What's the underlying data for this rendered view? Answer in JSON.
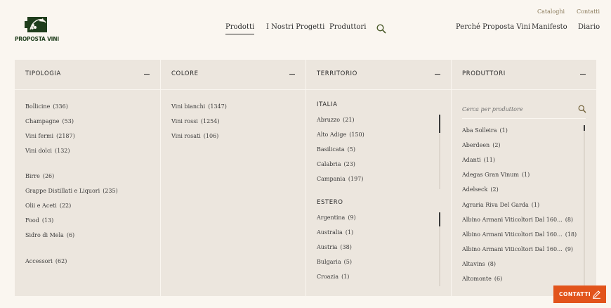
{
  "brand": {
    "name": "PROPOSTA VINI",
    "logo_icon": "grapevine-icon"
  },
  "utility_links": [
    "Cataloghi",
    "Contatti"
  ],
  "main_nav": [
    "Prodotti",
    "I Nostri Progetti",
    "Produttori"
  ],
  "secondary_nav": [
    "Perché Proposta Vini",
    "Manifesto",
    "Diario"
  ],
  "panel": {
    "tipologia": {
      "title": "TIPOLOGIA",
      "group1": [
        {
          "label": "Bollicine",
          "count": "(336)"
        },
        {
          "label": "Champagne",
          "count": "(53)"
        },
        {
          "label": "Vini fermi",
          "count": "(2187)"
        },
        {
          "label": "Vini dolci",
          "count": "(132)"
        }
      ],
      "group2": [
        {
          "label": "Birre",
          "count": "(26)"
        },
        {
          "label": "Grappe Distillati e Liquori",
          "count": "(235)"
        },
        {
          "label": "Olii e Aceti",
          "count": "(22)"
        },
        {
          "label": "Food",
          "count": "(13)"
        },
        {
          "label": "Sidro di Mela",
          "count": "(6)"
        }
      ],
      "group3": [
        {
          "label": "Accessori",
          "count": "(62)"
        }
      ]
    },
    "colore": {
      "title": "COLORE",
      "items": [
        {
          "label": "Vini bianchi",
          "count": "(1347)"
        },
        {
          "label": "Vini rossi",
          "count": "(1254)"
        },
        {
          "label": "Vini rosati",
          "count": "(106)"
        }
      ]
    },
    "territorio": {
      "title": "TERRITORIO",
      "italia_title": "ITALIA",
      "italia": [
        {
          "label": "Abruzzo",
          "count": "(21)"
        },
        {
          "label": "Alto Adige",
          "count": "(150)"
        },
        {
          "label": "Basilicata",
          "count": "(5)"
        },
        {
          "label": "Calabria",
          "count": "(23)"
        },
        {
          "label": "Campania",
          "count": "(197)"
        }
      ],
      "estero_title": "ESTERO",
      "estero": [
        {
          "label": "Argentina",
          "count": "(9)"
        },
        {
          "label": "Australia",
          "count": "(1)"
        },
        {
          "label": "Austria",
          "count": "(38)"
        },
        {
          "label": "Bulgaria",
          "count": "(5)"
        },
        {
          "label": "Croazia",
          "count": "(1)"
        }
      ]
    },
    "produttori": {
      "title": "PRODUTTORI",
      "search_placeholder": "Cerca per produttore",
      "items": [
        {
          "label": "Aba Solleira",
          "count": "(1)"
        },
        {
          "label": "Aberdeen",
          "count": "(2)"
        },
        {
          "label": "Adanti",
          "count": "(11)"
        },
        {
          "label": "Adegas Gran Vinum",
          "count": "(1)"
        },
        {
          "label": "Adelseck",
          "count": "(2)"
        },
        {
          "label": "Agraria Riva Del Garda",
          "count": "(1)"
        },
        {
          "label": "Albino Armani Viticoltori Dal 160...",
          "count": "(8)"
        },
        {
          "label": "Albino Armani Viticoltori Dal 160...",
          "count": "(18)"
        },
        {
          "label": "Albino Armani Viticoltori Dal 160...",
          "count": "(9)"
        },
        {
          "label": "Altavins",
          "count": "(8)"
        },
        {
          "label": "Altomonte",
          "count": "(6)"
        }
      ]
    }
  },
  "contact_button": {
    "label": "CONTATTI",
    "icon": "pencil-icon"
  },
  "colors": {
    "background": "#faf6f0",
    "panel": "#ece6de",
    "accent": "#e2541c",
    "brand_green": "#1f3d1c"
  }
}
